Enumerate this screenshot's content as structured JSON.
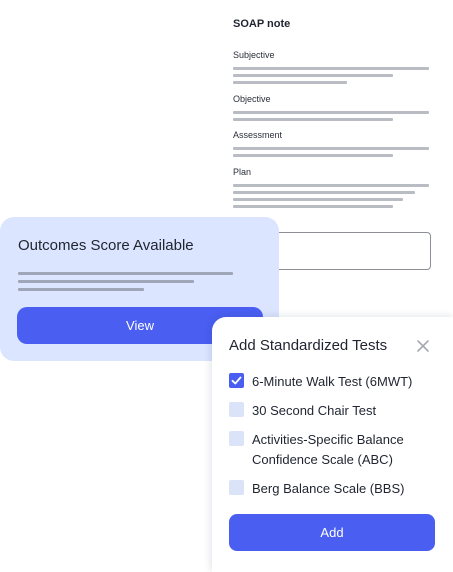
{
  "soap": {
    "title": "SOAP note",
    "sections": [
      "Subjective",
      "Objective",
      "Assessment",
      "Plan"
    ]
  },
  "outcomes": {
    "title": "Outcomes Score Available",
    "view_label": "View"
  },
  "modal": {
    "title": "Add Standardized Tests",
    "close_icon": "close-icon",
    "tests": [
      {
        "label": "6-Minute Walk Test (6MWT)",
        "checked": true
      },
      {
        "label": "30 Second Chair Test",
        "checked": false
      },
      {
        "label": "Activities-Specific Balance Confidence Scale (ABC)",
        "checked": false
      },
      {
        "label": "Berg Balance Scale (BBS)",
        "checked": false
      }
    ],
    "add_label": "Add"
  },
  "colors": {
    "accent": "#4a5ff2",
    "card_bg": "#dbe5ff",
    "checkbox_bg": "#dbe3f9"
  }
}
